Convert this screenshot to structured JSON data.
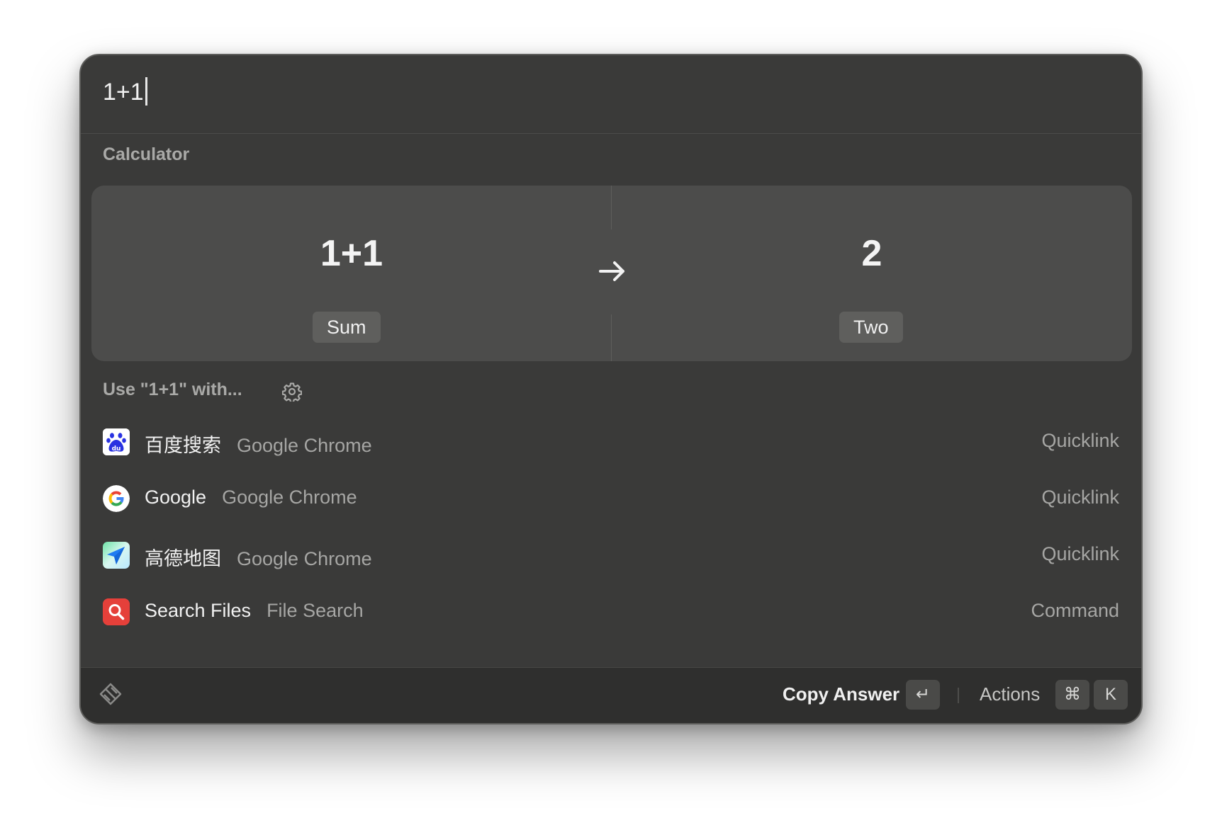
{
  "search": {
    "query": "1+1"
  },
  "calculator": {
    "section_title": "Calculator",
    "input": "1+1",
    "input_label": "Sum",
    "result": "2",
    "result_label": "Two"
  },
  "fallback": {
    "title": "Use \"1+1\" with...",
    "items": [
      {
        "title": "百度搜索",
        "subtitle": "Google Chrome",
        "accessory": "Quicklink",
        "icon": "baidu-icon"
      },
      {
        "title": "Google",
        "subtitle": "Google Chrome",
        "accessory": "Quicklink",
        "icon": "google-icon"
      },
      {
        "title": "高德地图",
        "subtitle": "Google Chrome",
        "accessory": "Quicklink",
        "icon": "amap-icon"
      },
      {
        "title": "Search Files",
        "subtitle": "File Search",
        "accessory": "Command",
        "icon": "search-files-icon"
      }
    ]
  },
  "footer": {
    "primary_action": "Copy Answer",
    "primary_shortcut": "↵",
    "secondary_action": "Actions",
    "secondary_shortcut_mod": "⌘",
    "secondary_shortcut_key": "K"
  },
  "colors": {
    "window_bg": "#3a3a39",
    "card_bg": "#4c4c4b",
    "footer_bg": "#2f2f2e",
    "text_primary": "#f1f1f1",
    "text_secondary": "#a6a6a4",
    "search_files_red": "#e5403a",
    "baidu_blue": "#2932e1"
  }
}
